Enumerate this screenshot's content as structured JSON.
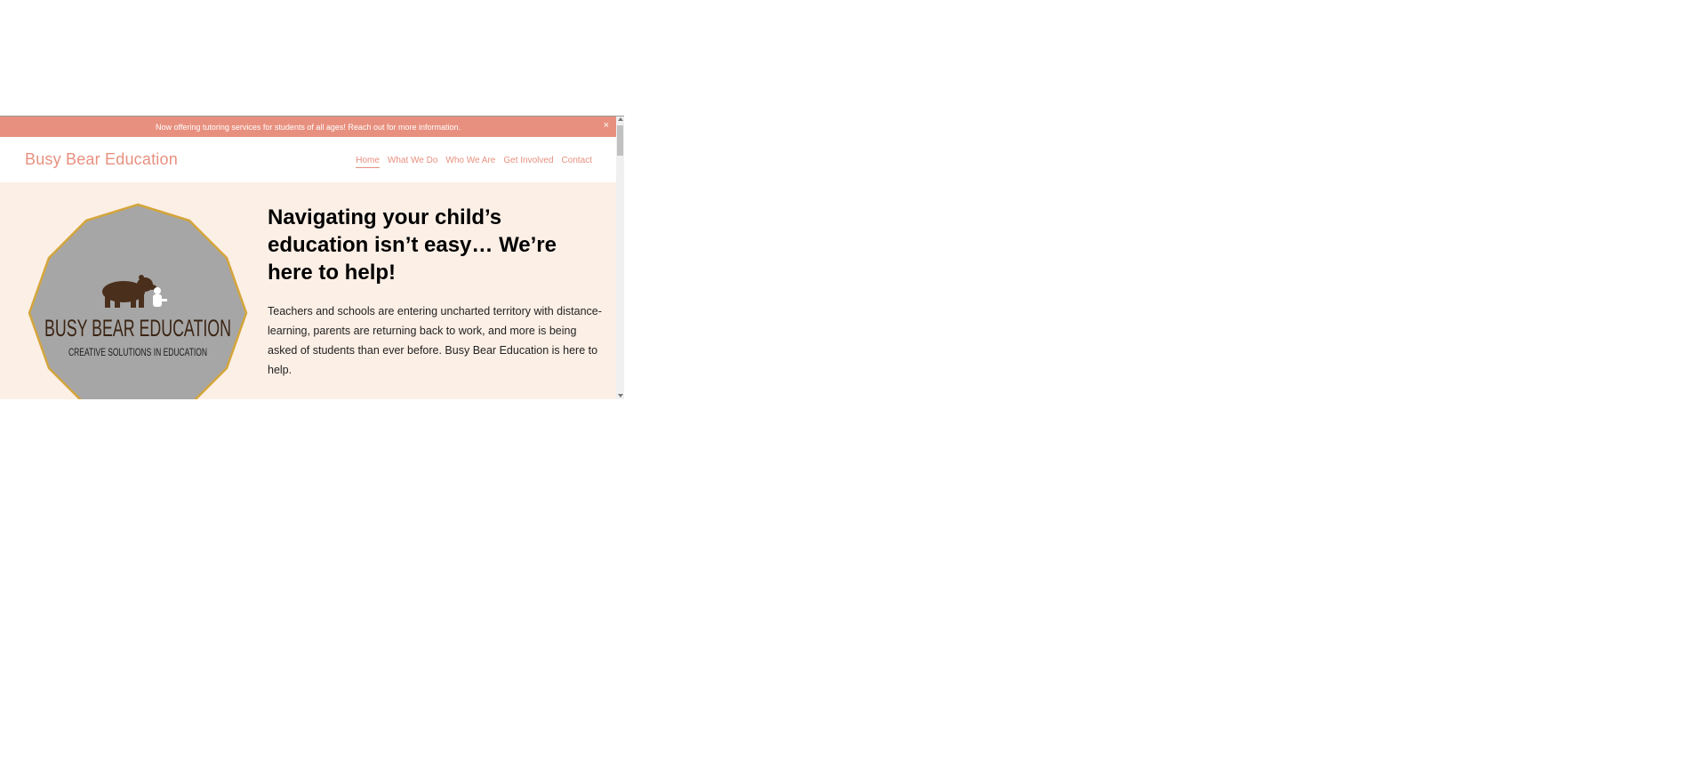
{
  "announcement": {
    "text": "Now offering tutoring services for students of all ages! Reach out for more information.",
    "close": "×"
  },
  "header": {
    "site_title": "Busy Bear Education",
    "nav": [
      {
        "label": "Home",
        "active": true
      },
      {
        "label": "What We Do"
      },
      {
        "label": "Who We Are"
      },
      {
        "label": "Get Involved"
      },
      {
        "label": "Contact"
      }
    ]
  },
  "hero": {
    "logo": {
      "title": "BUSY BEAR EDUCATION",
      "subtitle": "CREATIVE SOLUTIONS IN EDUCATION"
    },
    "heading": "Navigating your child’s education isn’t easy… We’re here to help!",
    "body": "Teachers and schools are entering uncharted territory with distance-learning, parents are returning back to work, and more is being asked of students than ever before. Busy Bear Education is here to help."
  },
  "colors": {
    "accent": "#e8907f",
    "hero_bg": "#fcefe6",
    "logo_fill": "#a6a6a6",
    "logo_border": "#d4a53a",
    "bear": "#4a2f1c"
  }
}
